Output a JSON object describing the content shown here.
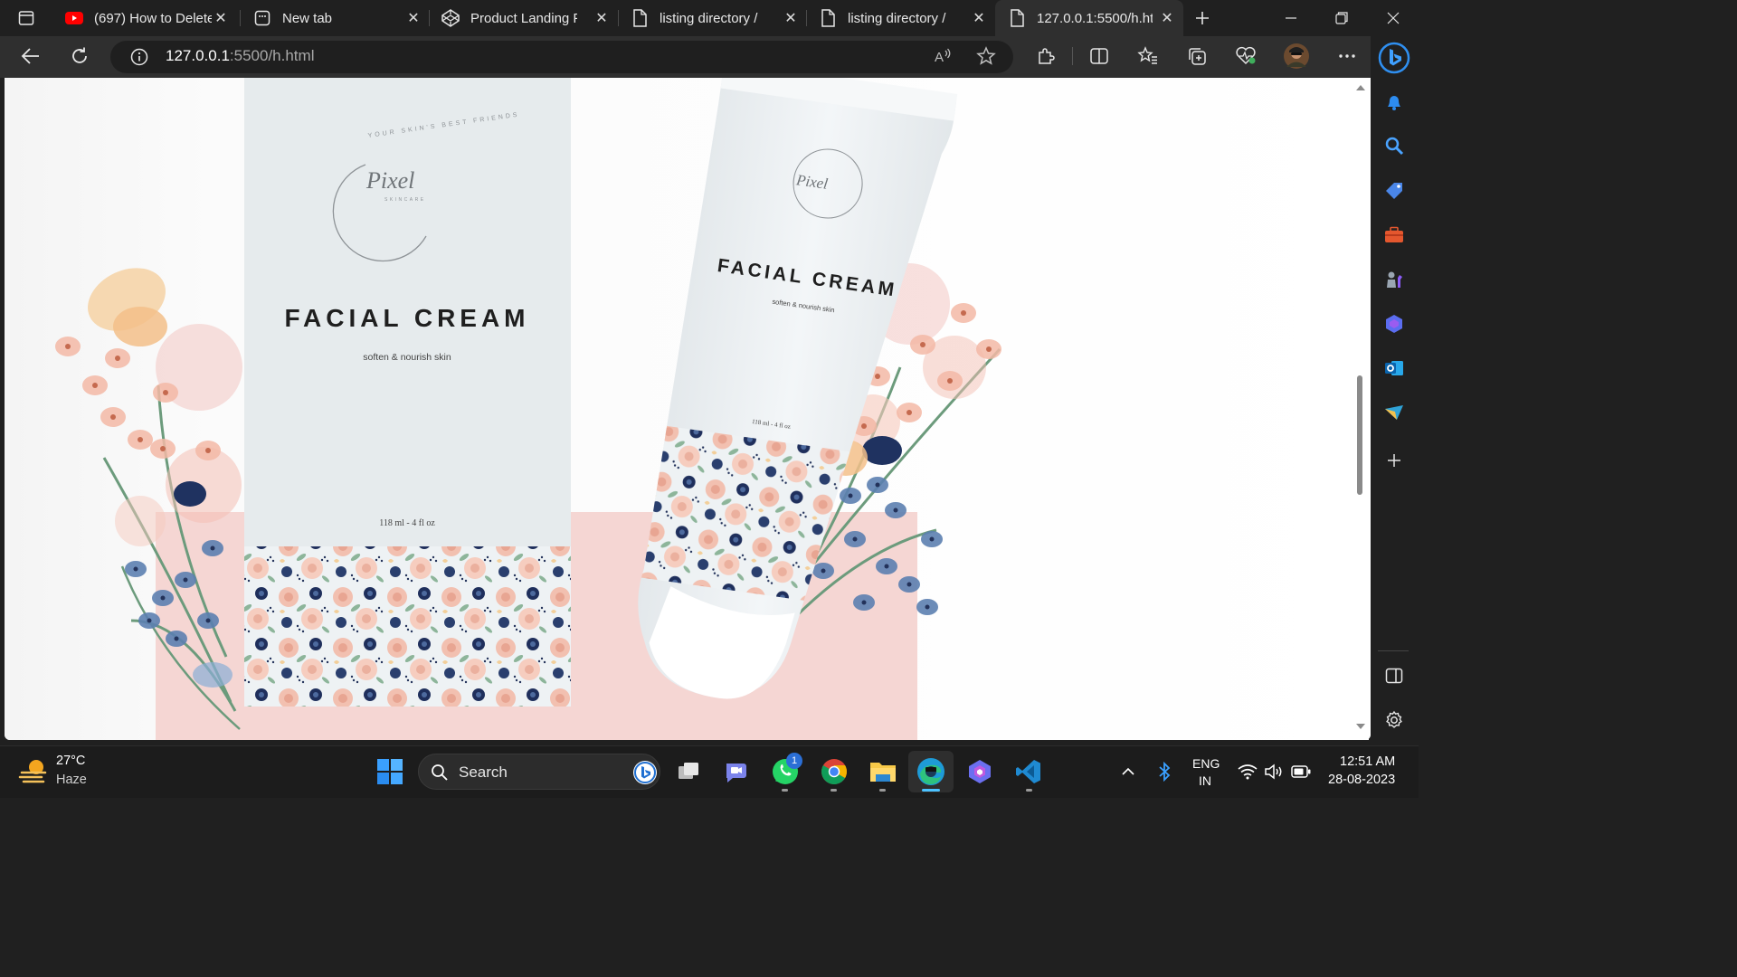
{
  "browser": {
    "tabs": [
      {
        "title": "(697) How to Delete",
        "icon": "youtube-icon"
      },
      {
        "title": "New tab",
        "icon": "new-tab-icon"
      },
      {
        "title": "Product Landing Pa",
        "icon": "codepen-icon"
      },
      {
        "title": "listing directory /",
        "icon": "page-icon"
      },
      {
        "title": "listing directory /",
        "icon": "page-icon"
      },
      {
        "title": "127.0.0.1:5500/h.htr",
        "icon": "page-icon",
        "active": true
      }
    ],
    "address": {
      "host": "127.0.0.1",
      "rest": ":5500/h.html"
    }
  },
  "page": {
    "box": {
      "brand_script": "Pixel",
      "brand_sub": "SKINCARE",
      "brand_ring": "YOUR SKIN'S BEST FRIENDS",
      "title": "FACIAL CREAM",
      "tagline": "soften & nourish skin",
      "volume": "118 ml - 4 fl oz"
    },
    "tube": {
      "brand_script": "Pixel",
      "title": "FACIAL CREAM",
      "tagline": "soften & nourish skin",
      "volume": "118 ml - 4 fl oz"
    },
    "colors": {
      "pink_bg": "#f5d6d3",
      "box": "#e7ecee",
      "tube": "#edf1f3"
    }
  },
  "taskbar": {
    "weather_temp": "27°C",
    "weather_desc": "Haze",
    "search_placeholder": "Search",
    "whatsapp_badge": "1",
    "lang_top": "ENG",
    "lang_bottom": "IN",
    "time": "12:51 AM",
    "date": "28-08-2023"
  }
}
